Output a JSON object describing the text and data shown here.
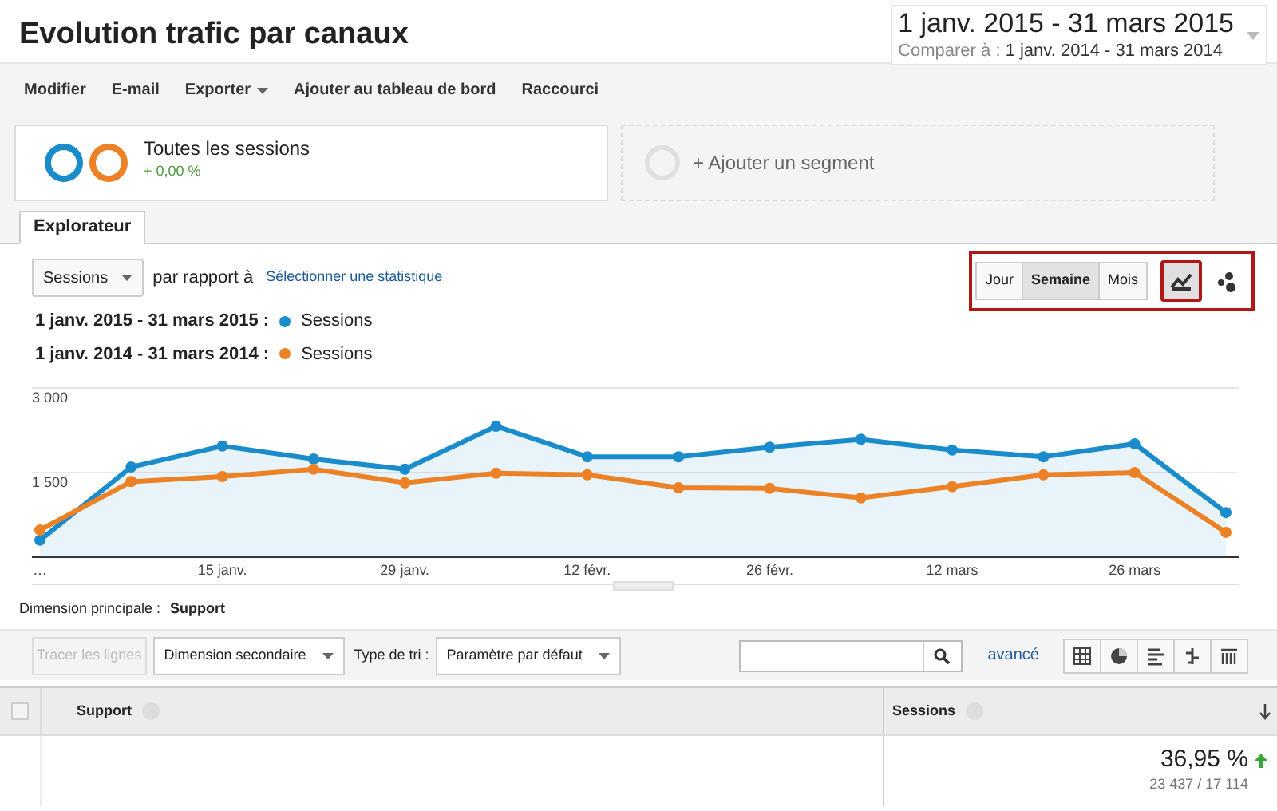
{
  "title": "Evolution trafic par canaux",
  "date_range": {
    "main": "1 janv. 2015 - 31 mars 2015",
    "compare_label": "Comparer à :",
    "compare_range": "1 janv. 2014 - 31 mars 2014"
  },
  "toolbar": [
    {
      "label": "Modifier",
      "dropdown": false
    },
    {
      "label": "E-mail",
      "dropdown": false
    },
    {
      "label": "Exporter",
      "dropdown": true
    },
    {
      "label": "Ajouter au tableau de bord",
      "dropdown": false
    },
    {
      "label": "Raccourci",
      "dropdown": false
    }
  ],
  "segments": [
    {
      "kind": "segment",
      "label": "Toutes les sessions",
      "change": "+ 0,00 %"
    },
    {
      "kind": "add",
      "label": "+ Ajouter un segment"
    }
  ],
  "tabs": [
    {
      "label": "Explorateur",
      "selected": true
    }
  ],
  "metric_select": {
    "value": "Sessions"
  },
  "compare_label": "par rapport à",
  "compare_link": "Sélectionner une statistique",
  "granularity": [
    {
      "label": "Jour",
      "selected": false
    },
    {
      "label": "Semaine",
      "selected": true
    },
    {
      "label": "Mois",
      "selected": false
    }
  ],
  "chart_types": [
    {
      "kind": "line",
      "selected": true
    },
    {
      "kind": "motion",
      "selected": false
    }
  ],
  "legend": [
    {
      "metric": "Sessions"
    },
    {
      "metric": "Sessions"
    }
  ],
  "chart": {
    "chart_data": {
      "type": "line",
      "categories": [
        "…",
        null,
        "15 janv.",
        null,
        "29 janv.",
        null,
        "12 févr.",
        null,
        "26 févr.",
        null,
        "12 mars",
        null,
        "26 mars",
        null
      ],
      "ylim": [
        0,
        3000
      ],
      "yticks": [
        {
          "value": 1500,
          "label": "1 500"
        },
        {
          "value": 3000,
          "label": "3 000"
        }
      ],
      "series": [
        {
          "name": "1 janv. 2015 - 31 mars 2015 :",
          "type": "area",
          "marker": "o",
          "color": "#1a8ccb",
          "values": [
            300,
            1600,
            1970,
            1740,
            1560,
            2320,
            1780,
            1780,
            1950,
            2090,
            1900,
            1780,
            2010,
            790
          ]
        },
        {
          "name": "1 janv. 2014 - 31 mars 2014 :",
          "type": "line",
          "marker": "o",
          "color": "#ed8125",
          "values": [
            480,
            1340,
            1430,
            1560,
            1320,
            1490,
            1460,
            1230,
            1220,
            1050,
            1250,
            1460,
            1500,
            440
          ]
        }
      ]
    }
  },
  "dimension": {
    "label": "Dimension principale :",
    "value": "Support"
  },
  "table_toolbar": {
    "plot_rows": {
      "label": "Tracer les lignes",
      "disabled": true
    },
    "secondary": "Dimension secondaire",
    "sort_label": "Type de tri :",
    "sort_value": "Paramètre par défaut",
    "advanced": "avancé",
    "views": [
      {
        "kind": "table",
        "selected": false
      },
      {
        "kind": "pie",
        "selected": false
      },
      {
        "kind": "bars",
        "selected": false
      },
      {
        "kind": "compare",
        "selected": false
      },
      {
        "kind": "pivot",
        "selected": false
      }
    ]
  },
  "table": {
    "select_all": {
      "checked": false
    },
    "columns": [
      {
        "label": "Support",
        "sorted": false
      },
      {
        "label": "Sessions",
        "sorted": true
      }
    ],
    "total": {
      "percent": "36,95 %",
      "increase": true,
      "values": "23 437 / 17 114"
    }
  }
}
